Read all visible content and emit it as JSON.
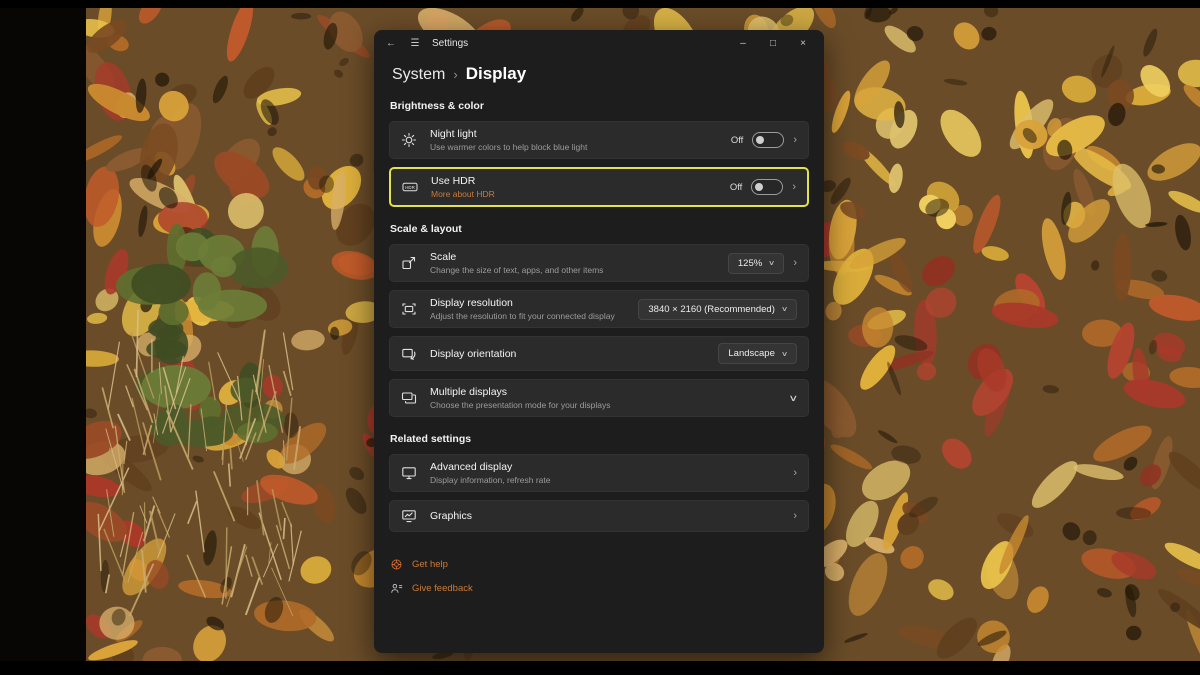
{
  "titlebar": {
    "title": "Settings"
  },
  "glyphs": {
    "back": "←",
    "menu": "☰",
    "minimize": "–",
    "maximize": "□",
    "close": "×",
    "breadcrumb_sep": "›",
    "chevron_right": "›",
    "chevron_down": "∨"
  },
  "breadcrumb": {
    "parent": "System",
    "current": "Display"
  },
  "sections": {
    "brightness": {
      "header": "Brightness & color"
    },
    "scale_layout": {
      "header": "Scale & layout"
    },
    "related": {
      "header": "Related settings"
    }
  },
  "cards": {
    "night_light": {
      "title": "Night light",
      "subtitle": "Use warmer colors to help block blue light",
      "state": "Off"
    },
    "use_hdr": {
      "title": "Use HDR",
      "link": "More about HDR",
      "state": "Off"
    },
    "scale": {
      "title": "Scale",
      "subtitle": "Change the size of text, apps, and other items",
      "value": "125%"
    },
    "resolution": {
      "title": "Display resolution",
      "subtitle": "Adjust the resolution to fit your connected display",
      "value": "3840 × 2160 (Recommended)"
    },
    "orientation": {
      "title": "Display orientation",
      "value": "Landscape"
    },
    "multiple_displays": {
      "title": "Multiple displays",
      "subtitle": "Choose the presentation mode for your displays"
    },
    "advanced_display": {
      "title": "Advanced display",
      "subtitle": "Display information, refresh rate"
    },
    "graphics": {
      "title": "Graphics"
    }
  },
  "footer": {
    "get_help": "Get help",
    "give_feedback": "Give feedback"
  },
  "colors": {
    "accent_link": "#CB7B38",
    "highlight_border": "#E2E24A"
  }
}
